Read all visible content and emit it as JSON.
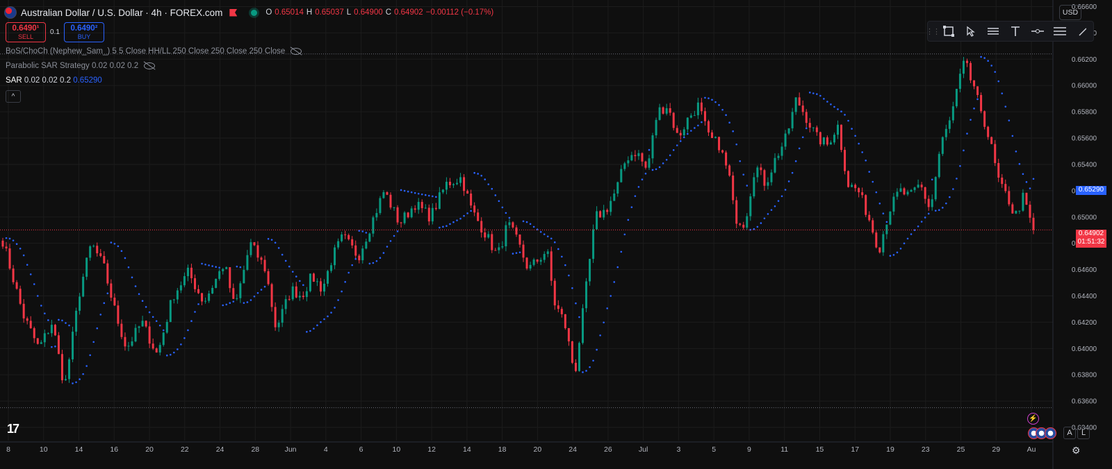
{
  "header": {
    "symbol": "Australian Dollar / U.S. Dollar · 4h · FOREX.com",
    "o_label": "O",
    "o": "0.65014",
    "h_label": "H",
    "h": "0.65037",
    "l_label": "L",
    "l": "0.64900",
    "c_label": "C",
    "c": "0.64902",
    "change": "−0.00112 (−0.17%)"
  },
  "trade": {
    "sell_price": "0.6490¹",
    "sell_label": "SELL",
    "qty": "0.1",
    "buy_price": "0.6490²",
    "buy_label": "BUY"
  },
  "indicators": [
    "BoS/ChoCh (Nephew_Sam_) 5 5 Close HH/LL 250 Close 250 Close 250 Close",
    "Parabolic SAR Strategy 0.02 0.02 0.2"
  ],
  "sar": {
    "name": "SAR",
    "params": "0.02 0.02 0.2",
    "value": "0.65290"
  },
  "currency": "USD",
  "collapse_glyph": "^",
  "toolbar_icons": [
    "grip-icon",
    "rectangle-icon",
    "cursor-icon",
    "range-icon",
    "text-icon",
    "horizontal-line-icon",
    "fib-icon",
    "trendline-icon"
  ],
  "logo": "17",
  "scale_buttons": {
    "auto": "A",
    "log": "L"
  },
  "price_tags": {
    "sar": "0.65290",
    "current": "0.64902",
    "countdown": "01:51:32"
  },
  "colors": {
    "up": "#089981",
    "down": "#f23645",
    "sar": "#2962ff",
    "background": "#0f0f0f",
    "grid": "#1c1c1c"
  },
  "chart_data": {
    "type": "candlestick",
    "y_axis": {
      "ticks": [
        "0.66600",
        "0.66400",
        "0.66200",
        "0.66000",
        "0.65800",
        "0.65600",
        "0.65400",
        "0.65200",
        "0.65000",
        "0.64800",
        "0.64600",
        "0.64400",
        "0.64200",
        "0.64000",
        "0.63800",
        "0.63600",
        "0.63400"
      ],
      "range": [
        0.633,
        0.6665
      ]
    },
    "x_axis": {
      "ticks": [
        "8",
        "10",
        "14",
        "16",
        "20",
        "22",
        "24",
        "28",
        "Jun",
        "4",
        "6",
        "10",
        "12",
        "14",
        "18",
        "20",
        "24",
        "26",
        "Jul",
        "3",
        "5",
        "9",
        "11",
        "15",
        "17",
        "19",
        "23",
        "25",
        "29",
        "Au"
      ]
    },
    "last_close": 0.64902,
    "sar_last": 0.6529,
    "dotted_levels": [
      0.6624,
      0.6355
    ],
    "waypoints": [
      [
        0,
        0.6482
      ],
      [
        0.02,
        0.6425
      ],
      [
        0.035,
        0.64
      ],
      [
        0.048,
        0.642
      ],
      [
        0.06,
        0.637
      ],
      [
        0.075,
        0.6445
      ],
      [
        0.086,
        0.648
      ],
      [
        0.098,
        0.6462
      ],
      [
        0.11,
        0.6425
      ],
      [
        0.12,
        0.64
      ],
      [
        0.135,
        0.642
      ],
      [
        0.15,
        0.6395
      ],
      [
        0.165,
        0.644
      ],
      [
        0.18,
        0.6458
      ],
      [
        0.195,
        0.6435
      ],
      [
        0.205,
        0.645
      ],
      [
        0.215,
        0.6465
      ],
      [
        0.225,
        0.643
      ],
      [
        0.24,
        0.648
      ],
      [
        0.255,
        0.646
      ],
      [
        0.265,
        0.6415
      ],
      [
        0.28,
        0.6445
      ],
      [
        0.29,
        0.644
      ],
      [
        0.3,
        0.6455
      ],
      [
        0.31,
        0.6445
      ],
      [
        0.32,
        0.647
      ],
      [
        0.33,
        0.6485
      ],
      [
        0.345,
        0.647
      ],
      [
        0.36,
        0.65
      ],
      [
        0.37,
        0.652
      ],
      [
        0.385,
        0.6495
      ],
      [
        0.4,
        0.651
      ],
      [
        0.415,
        0.65
      ],
      [
        0.43,
        0.6525
      ],
      [
        0.445,
        0.653
      ],
      [
        0.455,
        0.6505
      ],
      [
        0.47,
        0.6485
      ],
      [
        0.48,
        0.647
      ],
      [
        0.49,
        0.6495
      ],
      [
        0.5,
        0.648
      ],
      [
        0.51,
        0.646
      ],
      [
        0.52,
        0.6468
      ],
      [
        0.528,
        0.6475
      ],
      [
        0.535,
        0.6435
      ],
      [
        0.545,
        0.642
      ],
      [
        0.555,
        0.638
      ],
      [
        0.565,
        0.644
      ],
      [
        0.575,
        0.65
      ],
      [
        0.585,
        0.6505
      ],
      [
        0.595,
        0.652
      ],
      [
        0.605,
        0.6545
      ],
      [
        0.615,
        0.655
      ],
      [
        0.625,
        0.6535
      ],
      [
        0.635,
        0.658
      ],
      [
        0.645,
        0.6585
      ],
      [
        0.655,
        0.656
      ],
      [
        0.665,
        0.6575
      ],
      [
        0.675,
        0.6585
      ],
      [
        0.685,
        0.656
      ],
      [
        0.695,
        0.6555
      ],
      [
        0.705,
        0.653
      ],
      [
        0.71,
        0.65
      ],
      [
        0.72,
        0.6495
      ],
      [
        0.73,
        0.654
      ],
      [
        0.74,
        0.6525
      ],
      [
        0.75,
        0.6545
      ],
      [
        0.76,
        0.656
      ],
      [
        0.77,
        0.659
      ],
      [
        0.78,
        0.6575
      ],
      [
        0.79,
        0.656
      ],
      [
        0.8,
        0.6555
      ],
      [
        0.81,
        0.657
      ],
      [
        0.82,
        0.6525
      ],
      [
        0.83,
        0.652
      ],
      [
        0.84,
        0.65
      ],
      [
        0.85,
        0.6475
      ],
      [
        0.86,
        0.6505
      ],
      [
        0.87,
        0.652
      ],
      [
        0.88,
        0.6515
      ],
      [
        0.89,
        0.6525
      ],
      [
        0.9,
        0.6505
      ],
      [
        0.91,
        0.6555
      ],
      [
        0.92,
        0.6575
      ],
      [
        0.93,
        0.661
      ],
      [
        0.935,
        0.662
      ],
      [
        0.94,
        0.66
      ],
      [
        0.95,
        0.658
      ],
      [
        0.96,
        0.655
      ],
      [
        0.965,
        0.653
      ],
      [
        0.97,
        0.652
      ],
      [
        0.975,
        0.6515
      ],
      [
        0.982,
        0.65
      ],
      [
        0.99,
        0.6515
      ],
      [
        0.995,
        0.6502
      ],
      [
        1,
        0.64902
      ]
    ]
  }
}
